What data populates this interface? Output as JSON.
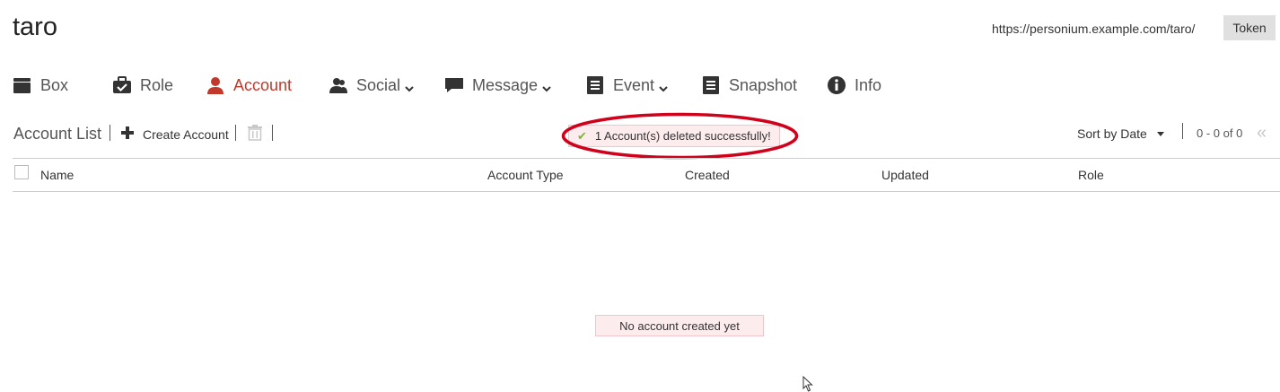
{
  "header": {
    "cell_name": "taro",
    "cell_url": "https://personium.example.com/taro/",
    "token_label": "Token"
  },
  "nav": {
    "items": [
      {
        "label": "Box",
        "icon": "box-icon",
        "dropdown": false
      },
      {
        "label": "Role",
        "icon": "role-icon",
        "dropdown": false
      },
      {
        "label": "Account",
        "icon": "account-icon",
        "dropdown": false,
        "active": true
      },
      {
        "label": "Social",
        "icon": "social-icon",
        "dropdown": true
      },
      {
        "label": "Message",
        "icon": "message-icon",
        "dropdown": true
      },
      {
        "label": "Event",
        "icon": "event-icon",
        "dropdown": true
      },
      {
        "label": "Snapshot",
        "icon": "snapshot-icon",
        "dropdown": false
      },
      {
        "label": "Info",
        "icon": "info-icon",
        "dropdown": false
      }
    ],
    "active_color": "#c0392b"
  },
  "toolbar": {
    "title": "Account List",
    "create_label": "Create Account",
    "sort_label": "Sort by Date",
    "pager": "0 - 0 of 0"
  },
  "notification": {
    "message": "1 Account(s) deleted successfully!",
    "highlight_color": "#d0021b"
  },
  "table": {
    "columns": [
      "Name",
      "Account Type",
      "Created",
      "Updated",
      "Role"
    ]
  },
  "empty_state": {
    "message": "No account created yet"
  }
}
